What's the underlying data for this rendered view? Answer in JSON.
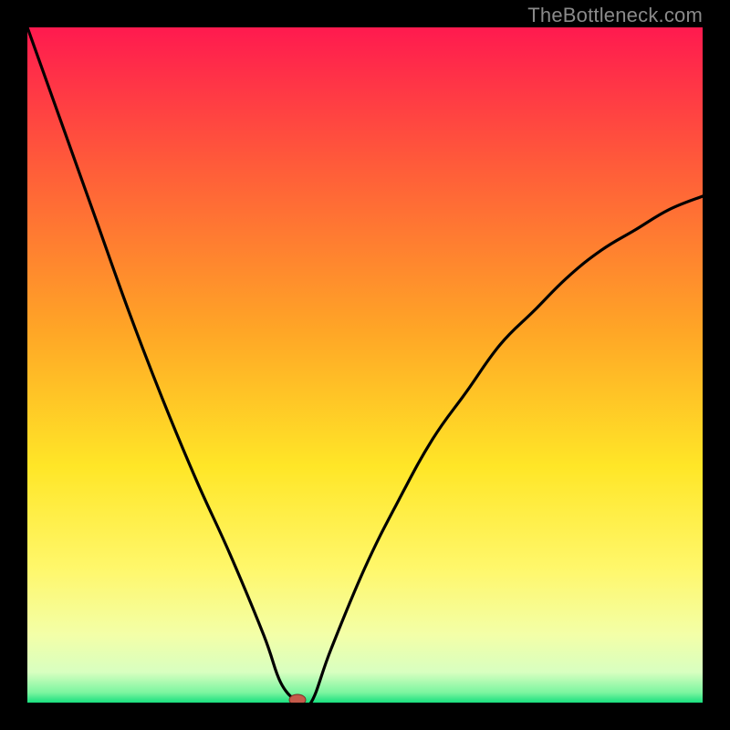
{
  "watermark": "TheBottleneck.com",
  "chart_data": {
    "type": "line",
    "title": "",
    "xlabel": "",
    "ylabel": "",
    "xlim": [
      0,
      100
    ],
    "ylim": [
      0,
      100
    ],
    "x": [
      0,
      5,
      10,
      15,
      20,
      25,
      30,
      35,
      37.5,
      40,
      42,
      45,
      50,
      55,
      60,
      65,
      70,
      75,
      80,
      85,
      90,
      95,
      100
    ],
    "values": [
      100,
      86,
      72,
      58,
      45,
      33,
      22,
      10,
      3,
      0,
      0,
      8,
      20,
      30,
      39,
      46,
      53,
      58,
      63,
      67,
      70,
      73,
      75
    ],
    "minimum_x": 40,
    "minimum_y": 0,
    "gradient_stops": [
      {
        "pos": 0.0,
        "color": "#ff1a4f"
      },
      {
        "pos": 0.2,
        "color": "#ff5a3a"
      },
      {
        "pos": 0.45,
        "color": "#ffa626"
      },
      {
        "pos": 0.65,
        "color": "#ffe627"
      },
      {
        "pos": 0.8,
        "color": "#fff76a"
      },
      {
        "pos": 0.9,
        "color": "#f3ffa8"
      },
      {
        "pos": 0.955,
        "color": "#d8ffc0"
      },
      {
        "pos": 0.985,
        "color": "#7cf5a0"
      },
      {
        "pos": 1.0,
        "color": "#19e07e"
      }
    ],
    "marker": {
      "x": 40,
      "y": 0,
      "color": "#c55a4a",
      "rx": 9,
      "ry": 6
    }
  }
}
